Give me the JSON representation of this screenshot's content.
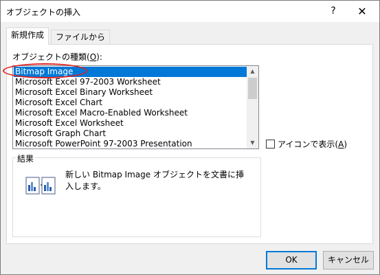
{
  "window": {
    "title": "オブジェクトの挿入",
    "help_label": "?",
    "close_label": "✕"
  },
  "tabs": [
    {
      "label": "新規作成",
      "selected": true
    },
    {
      "label": "ファイルから",
      "selected": false
    }
  ],
  "object_type": {
    "label_prefix": "オブジェクトの種類(",
    "label_access": "O",
    "label_suffix": "):",
    "items": [
      "Bitmap Image",
      "Microsoft Excel 97-2003 Worksheet",
      "Microsoft Excel Binary Worksheet",
      "Microsoft Excel Chart",
      "Microsoft Excel Macro-Enabled Worksheet",
      "Microsoft Excel Worksheet",
      "Microsoft Graph Chart",
      "Microsoft PowerPoint 97-2003 Presentation"
    ],
    "selected_index": 0
  },
  "display_as_icon": {
    "label_prefix": "アイコンで表示(",
    "label_access": "A",
    "label_suffix": ")",
    "checked": false
  },
  "result": {
    "label": "結果",
    "description": "新しい Bitmap Image オブジェクトを文書に挿入します。"
  },
  "buttons": {
    "ok": "OK",
    "cancel": "キャンセル"
  },
  "colors": {
    "selection": "#0078d7",
    "highlight_circle": "#e02020"
  }
}
